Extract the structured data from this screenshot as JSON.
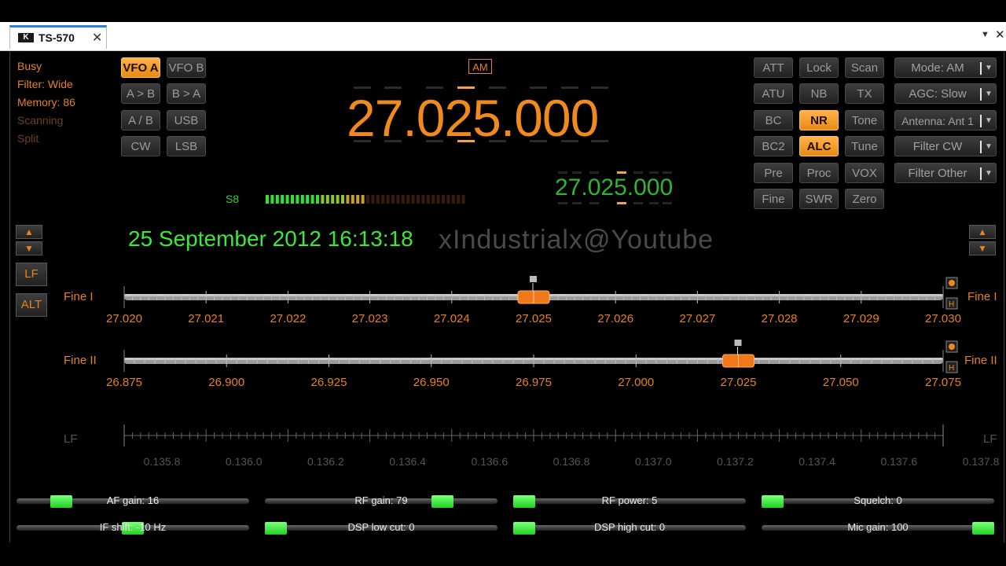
{
  "window": {
    "tab_title": "TS-570",
    "tab_logo": "K",
    "close_glyph": "✕",
    "menu_glyph": "▼",
    "window_close_glyph": "✕"
  },
  "status": {
    "busy": "Busy",
    "filter": "Filter: Wide",
    "memory": "Memory: 86",
    "scanning": "Scanning",
    "split": "Split"
  },
  "vfo_buttons": {
    "vfo_a": "VFO A",
    "vfo_b": "VFO B",
    "a_to_b": "A > B",
    "b_to_a": "B > A",
    "a_swap_b": "A / B",
    "usb": "USB",
    "cw": "CW",
    "lsb": "LSB"
  },
  "mode_badge": "AM",
  "main_frequency": "27.025.000",
  "sub_frequency": "27.025.000",
  "s_meter": {
    "label": "S8",
    "level_fraction": 0.5
  },
  "func_buttons": {
    "att": "ATT",
    "lock": "Lock",
    "scan": "Scan",
    "atu": "ATU",
    "nb": "NB",
    "tx": "TX",
    "bc": "BC",
    "nr": "NR",
    "tone": "Tone",
    "bc2": "BC2",
    "alc": "ALC",
    "tune": "Tune",
    "pre": "Pre",
    "proc": "Proc",
    "vox": "VOX",
    "fine": "Fine",
    "swr": "SWR",
    "zero": "Zero"
  },
  "dropdowns": {
    "mode": "Mode: AM",
    "agc": "AGC: Slow",
    "antenna": "Antenna: Ant 1",
    "filter_cw": "Filter CW",
    "filter_other": "Filter Other"
  },
  "datetime": "25 September 2012 16:13:18",
  "watermark": "xIndustrialx@Youtube",
  "side_buttons": {
    "lf": "LF",
    "alt": "ALT",
    "up_glyph": "▲",
    "down_glyph": "▼"
  },
  "fine1": {
    "label": "Fine I",
    "ticks": [
      "27.020",
      "27.021",
      "27.022",
      "27.023",
      "27.024",
      "27.025",
      "27.026",
      "27.027",
      "27.028",
      "27.029",
      "27.030"
    ],
    "value": 27.025
  },
  "fine2": {
    "label": "Fine II",
    "ticks": [
      "26.875",
      "26.900",
      "26.925",
      "26.950",
      "26.975",
      "27.000",
      "27.025",
      "27.050",
      "27.075"
    ],
    "value": 27.025
  },
  "lf_scale": {
    "label": "LF",
    "ticks": [
      "0.135.8",
      "0.136.0",
      "0.136.2",
      "0.136.4",
      "0.136.6",
      "0.136.8",
      "0.137.0",
      "0.137.2",
      "0.137.4",
      "0.137.6",
      "0.137.8"
    ]
  },
  "sliders": [
    {
      "label": "AF gain: 16",
      "fraction": 0.16
    },
    {
      "label": "RF gain: 79",
      "fraction": 0.79
    },
    {
      "label": "RF power: 5",
      "fraction": 0.0
    },
    {
      "label": "Squelch: 0",
      "fraction": 0.0
    },
    {
      "label": "IF shift: -10 Hz",
      "fraction": 0.5
    },
    {
      "label": "DSP low cut: 0",
      "fraction": 0.0
    },
    {
      "label": "DSP high cut: 0",
      "fraction": 0.0
    },
    {
      "label": "Mic gain: 100",
      "fraction": 1.0
    }
  ],
  "colors": {
    "accent": "#f08a1c",
    "green": "#3be83b",
    "background": "#000000"
  }
}
